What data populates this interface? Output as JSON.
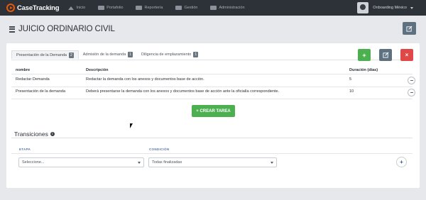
{
  "app": {
    "brand": "CaseTracking",
    "nav": [
      {
        "label": "Inicio",
        "icon": "home-icon"
      },
      {
        "label": "Portafolio",
        "icon": "briefcase-icon"
      },
      {
        "label": "Reportería",
        "icon": "chart-icon"
      },
      {
        "label": "Gestión",
        "icon": "folder-icon"
      },
      {
        "label": "Administración",
        "icon": "list-icon"
      }
    ],
    "user": "Onboarding México"
  },
  "page": {
    "title": "JUICIO ORDINARIO CIVIL"
  },
  "tabs": [
    {
      "label": "Presentación de la Demanda",
      "count": "2",
      "active": true
    },
    {
      "label": "Admisión de la demanda",
      "count": "1",
      "active": false
    },
    {
      "label": "Diligencia de emplazamiento",
      "count": "1",
      "active": false
    }
  ],
  "actions": {
    "add": "+",
    "delete": "×"
  },
  "table": {
    "headers": {
      "name": "nombre",
      "description": "Descripción",
      "duration": "Duración (días)"
    },
    "rows": [
      {
        "name": "Redactar Demanda",
        "description": "Redactar la demanda con los anexos y documentos base de acción.",
        "duration": "5"
      },
      {
        "name": "Presentación de la demanda",
        "description": "Deberá presentarse la demanda con los anexos y documentos base de acción ante la oficialía correspondiente.",
        "duration": "10"
      }
    ]
  },
  "create_task_label": "+ CREAR TAREA",
  "transitions": {
    "title": "Transiciones",
    "info": "i",
    "col_stage": "ETAPA",
    "col_condition": "CONDICIÓN",
    "stage_value": "Seleccione...",
    "condition_value": "Todas finalizadas",
    "add": "+"
  },
  "colors": {
    "topbar": "#2d3138",
    "brand_accent": "#e8590c",
    "success": "#4caf50",
    "secondary": "#5e7181",
    "danger": "#e04848",
    "column_label": "#5777a8"
  }
}
